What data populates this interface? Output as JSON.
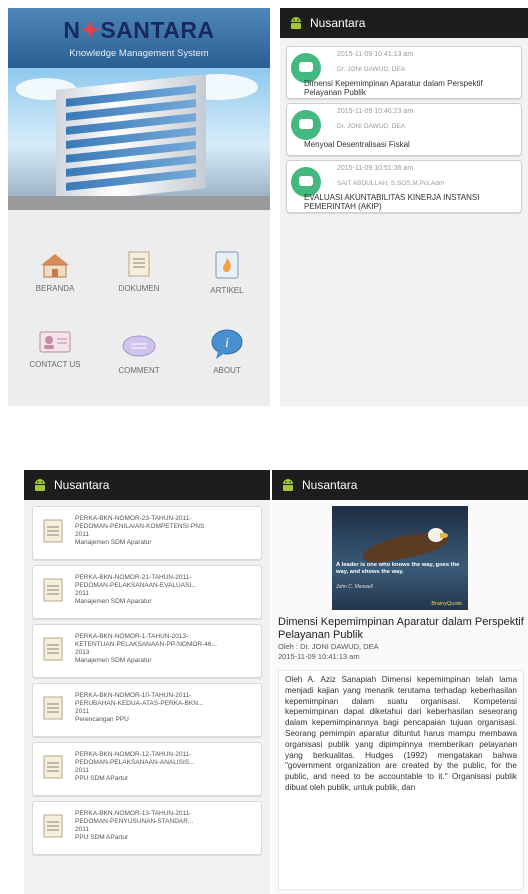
{
  "home": {
    "brand_title_n": "N",
    "brand_title_rest": "SANTARA",
    "brand_subtitle": "Knowledge Management System",
    "menu": [
      {
        "label": "BERANDA",
        "icon": "home-icon"
      },
      {
        "label": "DOKUMEN",
        "icon": "document-icon"
      },
      {
        "label": "ARTIKEL",
        "icon": "article-fire-icon"
      },
      {
        "label": "CONTACT US",
        "icon": "contact-card-icon"
      },
      {
        "label": "COMMENT",
        "icon": "comment-icon"
      },
      {
        "label": "ABOUT",
        "icon": "info-icon"
      }
    ]
  },
  "app_title": "Nusantara",
  "feed": [
    {
      "date": "2015-11-09 10:41:13 am",
      "author": "Dr. JONI DAWUD, DEA",
      "title": "Dimensi Kepemimpinan Aparatur dalam Perspektif Pelayanan Publik"
    },
    {
      "date": "2015-11-09 10:46:23 am",
      "author": "Dr. JONI DAWUD, DEA",
      "title": "Menyoal Desentralisasi Fiskal"
    },
    {
      "date": "2015-11-09 10:51:36 am",
      "author": "SAIT ABDULLAH, S.SOS,M.Pol.Adm",
      "title": "EVALUASI AKUNTABILITAS KINERJA INSTANSI PEMERINTAH (AKIP)"
    }
  ],
  "documents": [
    {
      "line1": "PERKA-BKN-NOMOR-23-TAHUN-2011-",
      "line2": "PEDOMAN-PENILAIAN-KOMPETENSI-PNS",
      "year": "2011",
      "category": "Manajemen SDM Aparatur"
    },
    {
      "line1": "PERKA-BKN-NOMOR-21-TAHUN-2011-",
      "line2": "PEDOMAN-PELAKSANAAN-EVALUASI...",
      "year": "2011",
      "category": "Manajemen SDM Aparatur"
    },
    {
      "line1": "PERKA-BKN-NOMOR-1-TAHUN-2013-",
      "line2": "KETENTUAN-PELAKSANAAN-PP-NOMOR-46...",
      "year": "2013",
      "category": "Manajemen SDM Aparatur"
    },
    {
      "line1": "PERKA-BKN-NOMOR-10-TAHUN-2011-",
      "line2": "PERUBAHAN-KEDUA-ATAS-PERKA-BKN...",
      "year": "2011",
      "category": "Perencangan PPU"
    },
    {
      "line1": "PERKA-BKN-NOMOR-12-TAHUN-2011-",
      "line2": "PEDOMAN-PELAKSANAAN-ANALISIS...",
      "year": "2011",
      "category": "PPU SDM APartur"
    },
    {
      "line1": "PERKA-BKN-NOMOR-13-TAHUN-2011-",
      "line2": "PEDOMAN-PENYUSUNAN-STANDAR...",
      "year": "2011",
      "category": "PPU SDM APartur"
    }
  ],
  "article": {
    "image_quote": "A leader is one who knows the way, goes the way, and shows the way.",
    "image_attribution": "John C. Maxwell",
    "image_logo": "BrainyQuote",
    "title": "Dimensi Kepemimpinan Aparatur dalam Perspektif Pelayanan Publik",
    "author": "Oleh : Dr. JONI DAWUD, DEA",
    "date": "2015-11-09 10:41:13 am",
    "body": "Oleh A. Aziz Sanapiah Dimensi kepemimpinan telah lama menjadi kajian yang menarik terutama terhadap keberhasilan kepemimpinan dalam suatu organisasi. Kompetensi kepemimpinan dapat diketahui dari keberhasilan seseorang dalam kepemimpinannya bagi pencapaian tujuan organisasi. Seorang pemimpin aparatur dituntut harus mampu membawa organisasi publik yang dipimpinnya memberikan pelayanan yang berkualitas. Hudges (1992) mengatakan bahwa \"government organization are created by the public, for the public, and need to be accountable to it.\" Organisasi publik dibuat oleh publik, untuk publik, dan"
  }
}
